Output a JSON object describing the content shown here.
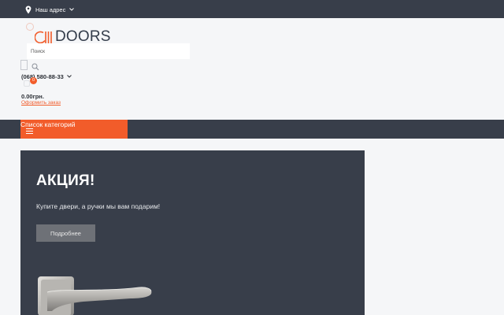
{
  "topbar": {
    "address_label": "Наш адрес"
  },
  "header": {
    "logo_text": "DOORS",
    "search_placeholder": "Поиск",
    "phone": "(068) 580-88-33",
    "cart_count": "0",
    "cart_total": "0.00грн.",
    "checkout_label": "Оформить заказ"
  },
  "nav": {
    "categories_label": "Список категорий"
  },
  "banner": {
    "title": "АКЦИЯ!",
    "subtitle": "Купите двери, а ручки мы вам подарим!",
    "button_label": "Подробнее"
  },
  "colors": {
    "accent": "#f25c2a",
    "dark": "#383e4a",
    "background": "#f5f6f8"
  }
}
